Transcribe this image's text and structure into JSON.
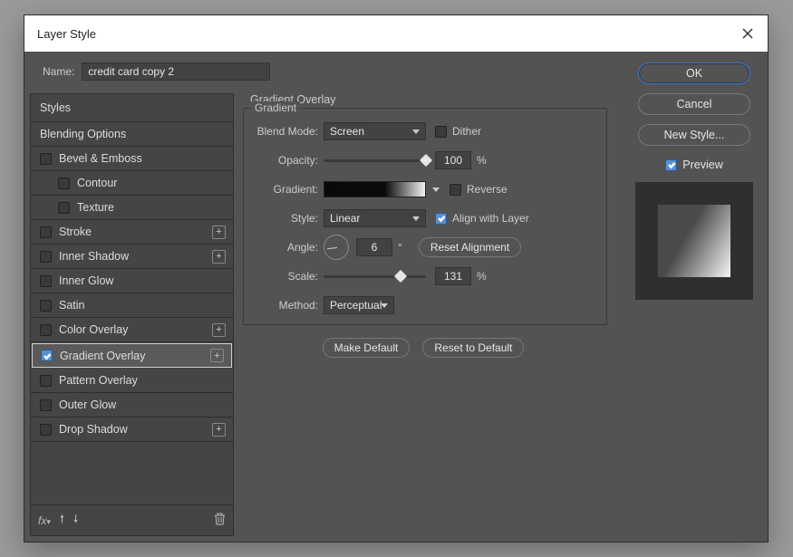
{
  "window": {
    "title": "Layer Style"
  },
  "name": {
    "label": "Name:",
    "value": "credit card copy 2"
  },
  "styles": {
    "header": "Styles",
    "items": [
      {
        "label": "Blending Options",
        "checkbox": false,
        "plus": false,
        "indent": false
      },
      {
        "label": "Bevel & Emboss",
        "checkbox": true,
        "checked": false,
        "plus": false,
        "indent": false
      },
      {
        "label": "Contour",
        "checkbox": true,
        "checked": false,
        "plus": false,
        "indent": true
      },
      {
        "label": "Texture",
        "checkbox": true,
        "checked": false,
        "plus": false,
        "indent": true
      },
      {
        "label": "Stroke",
        "checkbox": true,
        "checked": false,
        "plus": true,
        "indent": false
      },
      {
        "label": "Inner Shadow",
        "checkbox": true,
        "checked": false,
        "plus": true,
        "indent": false
      },
      {
        "label": "Inner Glow",
        "checkbox": true,
        "checked": false,
        "plus": false,
        "indent": false
      },
      {
        "label": "Satin",
        "checkbox": true,
        "checked": false,
        "plus": false,
        "indent": false
      },
      {
        "label": "Color Overlay",
        "checkbox": true,
        "checked": false,
        "plus": true,
        "indent": false
      },
      {
        "label": "Gradient Overlay",
        "checkbox": true,
        "checked": true,
        "plus": true,
        "indent": false,
        "selected": true
      },
      {
        "label": "Pattern Overlay",
        "checkbox": true,
        "checked": false,
        "plus": false,
        "indent": false
      },
      {
        "label": "Outer Glow",
        "checkbox": true,
        "checked": false,
        "plus": false,
        "indent": false
      },
      {
        "label": "Drop Shadow",
        "checkbox": true,
        "checked": false,
        "plus": true,
        "indent": false
      }
    ]
  },
  "center": {
    "title": "Gradient Overlay",
    "legend": "Gradient",
    "blend_mode": {
      "label": "Blend Mode:",
      "value": "Screen"
    },
    "dither": {
      "label": "Dither",
      "checked": false
    },
    "opacity": {
      "label": "Opacity:",
      "value": "100",
      "unit": "%",
      "pct": 100
    },
    "gradient": {
      "label": "Gradient:"
    },
    "reverse": {
      "label": "Reverse",
      "checked": false
    },
    "style": {
      "label": "Style:",
      "value": "Linear"
    },
    "align": {
      "label": "Align with Layer",
      "checked": true
    },
    "angle": {
      "label": "Angle:",
      "value": "6",
      "unit": "°",
      "reset": "Reset Alignment"
    },
    "scale": {
      "label": "Scale:",
      "value": "131",
      "unit": "%",
      "pct": 75
    },
    "method": {
      "label": "Method:",
      "value": "Perceptual"
    },
    "make_default": "Make Default",
    "reset_default": "Reset to Default"
  },
  "right": {
    "ok": "OK",
    "cancel": "Cancel",
    "new_style": "New Style...",
    "preview_label": "Preview",
    "preview_checked": true
  },
  "footer_icons": {
    "fx": "fx",
    "up": "▲",
    "down": "▼",
    "trash": "🗑"
  }
}
